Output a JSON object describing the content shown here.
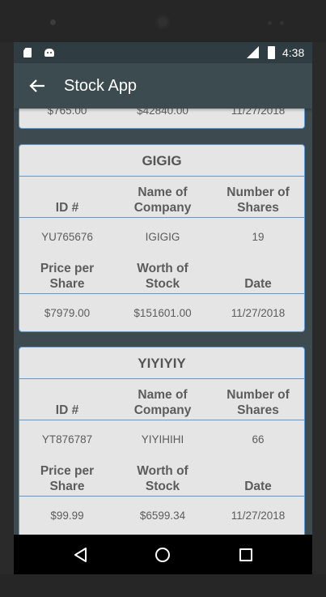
{
  "status_bar": {
    "time": "4:38",
    "network": "LTE"
  },
  "toolbar": {
    "title": "Stock App"
  },
  "labels": {
    "id": "ID #",
    "company": [
      "Name of",
      "Company"
    ],
    "shares": [
      "Number of",
      "Shares"
    ],
    "price": [
      "Price per",
      "Share"
    ],
    "worth": [
      "Worth of",
      "Stock"
    ],
    "date": "Date"
  },
  "partial_card": {
    "price": "$765.00",
    "worth": "$42840.00",
    "date": "11/27/2018"
  },
  "stocks": [
    {
      "symbol": "GIGIG",
      "id": "YU765676",
      "company": "IGIGIG",
      "shares": "19",
      "price": "$7979.00",
      "worth": "$151601.00",
      "date": "11/27/2018"
    },
    {
      "symbol": "YIYIYIY",
      "id": "YT876787",
      "company": "YIYIHIHI",
      "shares": "66",
      "price": "$99.99",
      "worth": "$6599.34",
      "date": "11/27/2018"
    }
  ],
  "colors": {
    "toolbar": "#3c4b50",
    "card_border": "#5b9bd5",
    "card_bg": "#e5e5e5"
  }
}
